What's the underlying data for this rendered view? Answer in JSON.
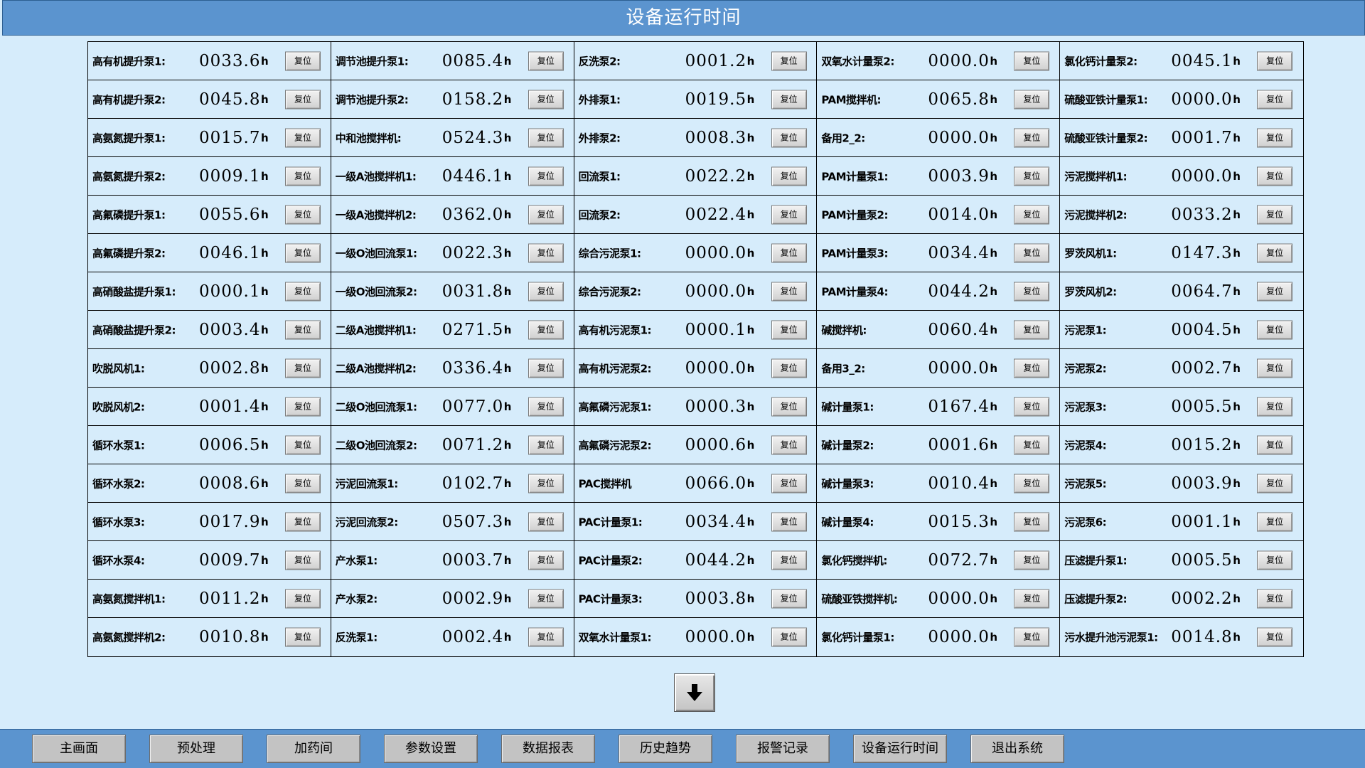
{
  "title": "设备运行时间",
  "reset_label": "复位",
  "unit": "h",
  "columns": [
    [
      {
        "label": "高有机提升泵1:",
        "value": "0033.6"
      },
      {
        "label": "高有机提升泵2:",
        "value": "0045.8"
      },
      {
        "label": "高氨氮提升泵1:",
        "value": "0015.7"
      },
      {
        "label": "高氨氮提升泵2:",
        "value": "0009.1"
      },
      {
        "label": "高氟磷提升泵1:",
        "value": "0055.6"
      },
      {
        "label": "高氟磷提升泵2:",
        "value": "0046.1"
      },
      {
        "label": "高硝酸盐提升泵1:",
        "value": "0000.1"
      },
      {
        "label": "高硝酸盐提升泵2:",
        "value": "0003.4"
      },
      {
        "label": "吹脱风机1:",
        "value": "0002.8"
      },
      {
        "label": "吹脱风机2:",
        "value": "0001.4"
      },
      {
        "label": "循环水泵1:",
        "value": "0006.5"
      },
      {
        "label": "循环水泵2:",
        "value": "0008.6"
      },
      {
        "label": "循环水泵3:",
        "value": "0017.9"
      },
      {
        "label": "循环水泵4:",
        "value": "0009.7"
      },
      {
        "label": "高氨氮搅拌机1:",
        "value": "0011.2"
      },
      {
        "label": "高氨氮搅拌机2:",
        "value": "0010.8"
      }
    ],
    [
      {
        "label": "调节池提升泵1:",
        "value": "0085.4"
      },
      {
        "label": "调节池提升泵2:",
        "value": "0158.2"
      },
      {
        "label": "中和池搅拌机:",
        "value": "0524.3"
      },
      {
        "label": "一级A池搅拌机1:",
        "value": "0446.1"
      },
      {
        "label": "一级A池搅拌机2:",
        "value": "0362.0"
      },
      {
        "label": "一级O池回流泵1:",
        "value": "0022.3"
      },
      {
        "label": "一级O池回流泵2:",
        "value": "0031.8"
      },
      {
        "label": "二级A池搅拌机1:",
        "value": "0271.5"
      },
      {
        "label": "二级A池搅拌机2:",
        "value": "0336.4"
      },
      {
        "label": "二级O池回流泵1:",
        "value": "0077.0"
      },
      {
        "label": "二级O池回流泵2:",
        "value": "0071.2"
      },
      {
        "label": "污泥回流泵1:",
        "value": "0102.7"
      },
      {
        "label": "污泥回流泵2:",
        "value": "0507.3"
      },
      {
        "label": "产水泵1:",
        "value": "0003.7"
      },
      {
        "label": "产水泵2:",
        "value": "0002.9"
      },
      {
        "label": "反洗泵1:",
        "value": "0002.4"
      }
    ],
    [
      {
        "label": "反洗泵2:",
        "value": "0001.2"
      },
      {
        "label": "外排泵1:",
        "value": "0019.5"
      },
      {
        "label": "外排泵2:",
        "value": "0008.3"
      },
      {
        "label": "回流泵1:",
        "value": "0022.2"
      },
      {
        "label": "回流泵2:",
        "value": "0022.4"
      },
      {
        "label": "综合污泥泵1:",
        "value": "0000.0"
      },
      {
        "label": "综合污泥泵2:",
        "value": "0000.0"
      },
      {
        "label": "高有机污泥泵1:",
        "value": "0000.1"
      },
      {
        "label": "高有机污泥泵2:",
        "value": "0000.0"
      },
      {
        "label": "高氟磷污泥泵1:",
        "value": "0000.3"
      },
      {
        "label": "高氟磷污泥泵2:",
        "value": "0000.6"
      },
      {
        "label": "PAC搅拌机",
        "value": "0066.0"
      },
      {
        "label": "PAC计量泵1:",
        "value": "0034.4"
      },
      {
        "label": "PAC计量泵2:",
        "value": "0044.2"
      },
      {
        "label": "PAC计量泵3:",
        "value": "0003.8"
      },
      {
        "label": "双氧水计量泵1:",
        "value": "0000.0"
      }
    ],
    [
      {
        "label": "双氧水计量泵2:",
        "value": "0000.0"
      },
      {
        "label": "PAM搅拌机:",
        "value": "0065.8"
      },
      {
        "label": "备用2_2:",
        "value": "0000.0"
      },
      {
        "label": "PAM计量泵1:",
        "value": "0003.9"
      },
      {
        "label": "PAM计量泵2:",
        "value": "0014.0"
      },
      {
        "label": "PAM计量泵3:",
        "value": "0034.4"
      },
      {
        "label": "PAM计量泵4:",
        "value": "0044.2"
      },
      {
        "label": "碱搅拌机:",
        "value": "0060.4"
      },
      {
        "label": "备用3_2:",
        "value": "0000.0"
      },
      {
        "label": "碱计量泵1:",
        "value": "0167.4"
      },
      {
        "label": "碱计量泵2:",
        "value": "0001.6"
      },
      {
        "label": "碱计量泵3:",
        "value": "0010.4"
      },
      {
        "label": "碱计量泵4:",
        "value": "0015.3"
      },
      {
        "label": "氯化钙搅拌机:",
        "value": "0072.7"
      },
      {
        "label": "硫酸亚铁搅拌机:",
        "value": "0000.0"
      },
      {
        "label": "氯化钙计量泵1:",
        "value": "0000.0"
      }
    ],
    [
      {
        "label": "氯化钙计量泵2:",
        "value": "0045.1"
      },
      {
        "label": "硫酸亚铁计量泵1:",
        "value": "0000.0"
      },
      {
        "label": "硫酸亚铁计量泵2:",
        "value": "0001.7"
      },
      {
        "label": "污泥搅拌机1:",
        "value": "0000.0"
      },
      {
        "label": "污泥搅拌机2:",
        "value": "0033.2"
      },
      {
        "label": "罗茨风机1:",
        "value": "0147.3"
      },
      {
        "label": "罗茨风机2:",
        "value": "0064.7"
      },
      {
        "label": "污泥泵1:",
        "value": "0004.5"
      },
      {
        "label": "污泥泵2:",
        "value": "0002.7"
      },
      {
        "label": "污泥泵3:",
        "value": "0005.5"
      },
      {
        "label": "污泥泵4:",
        "value": "0015.2"
      },
      {
        "label": "污泥泵5:",
        "value": "0003.9"
      },
      {
        "label": "污泥泵6:",
        "value": "0001.1"
      },
      {
        "label": "压滤提升泵1:",
        "value": "0005.5"
      },
      {
        "label": "压滤提升泵2:",
        "value": "0002.2"
      },
      {
        "label": "污水提升池污泥泵1:",
        "value": "0014.8"
      }
    ]
  ],
  "scroll_down_icon": "arrow-down-icon",
  "nav": [
    "主画面",
    "预处理",
    "加药间",
    "参数设置",
    "数据报表",
    "历史趋势",
    "报警记录",
    "设备运行时间",
    "退出系统"
  ]
}
